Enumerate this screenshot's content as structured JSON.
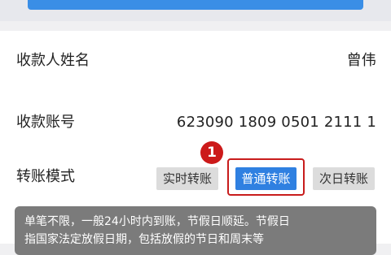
{
  "recipient": {
    "name_label": "收款人姓名",
    "name_value": "曾伟",
    "account_label": "收款账号",
    "account_value": "623090 1809 0501 2111 1"
  },
  "transfer_mode": {
    "label": "转账模式",
    "options": [
      {
        "label": "实时转账",
        "selected": false
      },
      {
        "label": "普通转账",
        "selected": true
      },
      {
        "label": "次日转账",
        "selected": false
      }
    ]
  },
  "annotation": {
    "badge": "1",
    "highlight_color": "#c81c1c"
  },
  "tooltip": {
    "line1": "单笔不限，一般24小时内到账，节假日顺延。节假日",
    "line2": "指国家法定放假日期，包括放假的节日和周末等"
  },
  "colors": {
    "accent": "#2f80e1",
    "page_bg": "#f0f0f2"
  }
}
